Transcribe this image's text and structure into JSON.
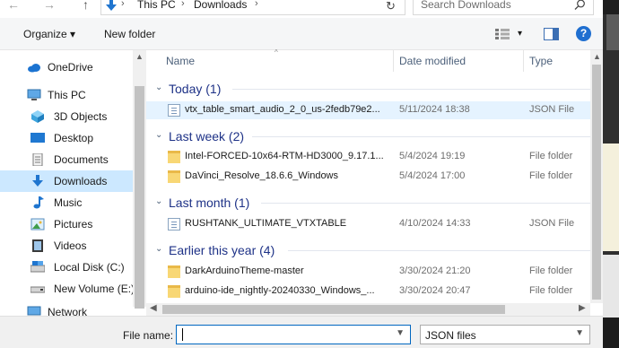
{
  "address": {
    "back": "←",
    "forward": "→",
    "up": "↑",
    "crumbs": [
      "This PC",
      "Downloads"
    ],
    "sep": "›",
    "refresh": "↻",
    "search_placeholder": "Search Downloads"
  },
  "toolbar": {
    "organize": "Organize ▾",
    "new_folder": "New folder",
    "view_dd": "▾",
    "help": "?"
  },
  "nav": {
    "items": [
      {
        "label": "OneDrive",
        "icon": "cloud-icon"
      },
      {
        "label": "This PC",
        "icon": "computer-icon"
      },
      {
        "label": "3D Objects",
        "icon": "cube-icon"
      },
      {
        "label": "Desktop",
        "icon": "desktop-icon"
      },
      {
        "label": "Documents",
        "icon": "document-icon"
      },
      {
        "label": "Downloads",
        "icon": "download-icon"
      },
      {
        "label": "Music",
        "icon": "music-icon"
      },
      {
        "label": "Pictures",
        "icon": "picture-icon"
      },
      {
        "label": "Videos",
        "icon": "video-icon"
      },
      {
        "label": "Local Disk (C:)",
        "icon": "drive-icon"
      },
      {
        "label": "New Volume (E:)",
        "icon": "drive-icon"
      },
      {
        "label": "Network",
        "icon": "network-icon"
      }
    ]
  },
  "columns": {
    "name": "Name",
    "date": "Date modified",
    "type": "Type"
  },
  "groups": [
    {
      "label": "Today (1)",
      "files": [
        {
          "name": "vtx_table_smart_audio_2_0_us-2fedb79e2...",
          "date": "5/11/2024 18:38",
          "type": "JSON File",
          "kind": "json"
        }
      ]
    },
    {
      "label": "Last week (2)",
      "files": [
        {
          "name": "Intel-FORCED-10x64-RTM-HD3000_9.17.1...",
          "date": "5/4/2024 19:19",
          "type": "File folder",
          "kind": "folder"
        },
        {
          "name": "DaVinci_Resolve_18.6.6_Windows",
          "date": "5/4/2024 17:00",
          "type": "File folder",
          "kind": "folder"
        }
      ]
    },
    {
      "label": "Last month (1)",
      "files": [
        {
          "name": "RUSHTANK_ULTIMATE_VTXTABLE",
          "date": "4/10/2024 14:33",
          "type": "JSON File",
          "kind": "json"
        }
      ]
    },
    {
      "label": "Earlier this year (4)",
      "files": [
        {
          "name": "DarkArduinoTheme-master",
          "date": "3/30/2024 21:20",
          "type": "File folder",
          "kind": "folder"
        },
        {
          "name": "arduino-ide_nightly-20240330_Windows_...",
          "date": "3/30/2024 20:47",
          "type": "File folder",
          "kind": "folder"
        }
      ]
    }
  ],
  "bottom": {
    "file_name_label": "File name:",
    "file_name_value": "",
    "file_type": "JSON files"
  },
  "colors": {
    "accent": "#0067c0",
    "selection": "#cce8ff",
    "group_text": "#1e3287"
  }
}
